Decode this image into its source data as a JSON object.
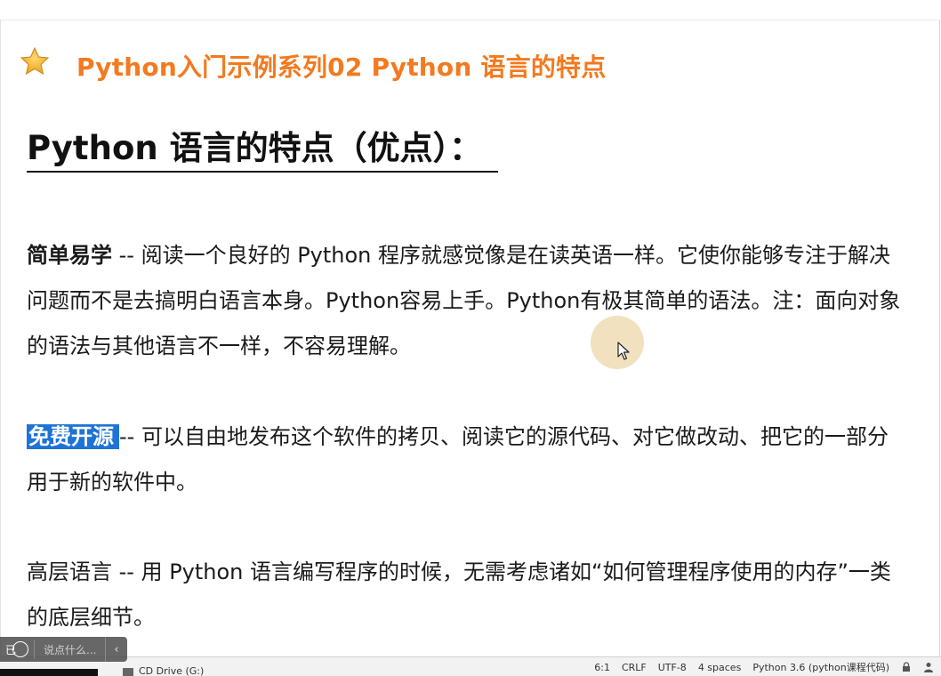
{
  "header": {
    "series_title": "Python入门示例系列02 Python 语言的特点"
  },
  "main": {
    "heading": "Python 语言的特点（优点）："
  },
  "paragraphs": [
    {
      "term": "简单易学",
      "text": " -- 阅读一个良好的 Python 程序就感觉像是在读英语一样。它使你能够专注于解决问题而不是去搞明白语言本身。Python容易上手。Python有极其简单的语法。注：面向对象的语法与其他语言不一样，不容易理解。"
    },
    {
      "term": "免费开源",
      "text": "-- 可以自由地发布这个软件的拷贝、阅读它的源代码、对它做改动、把它的一部分用于新的软件中。"
    },
    {
      "term": "高层语言",
      "text": " -- 用 Python 语言编写程序的时候，无需考虑诸如“如何管理程序使用的内存”一类的底层细节。"
    }
  ],
  "status_bar": {
    "position": "6:1",
    "line_ending": "CRLF",
    "encoding": "UTF-8",
    "indent": "4 spaces",
    "interpreter": "Python 3.6 (python课程代码)"
  },
  "taskbar": {
    "drive_label": "CD Drive (G:)"
  },
  "chat": {
    "left_label": "已",
    "placeholder": "说点什么...",
    "collapse_glyph": "‹"
  },
  "icons": {
    "star": "star-icon",
    "pointer": "mouse-pointer-icon",
    "lock": "lock-icon",
    "person": "person-icon"
  },
  "colors": {
    "title_orange": "#f37a1f",
    "highlight_blue": "#1e73d6"
  }
}
